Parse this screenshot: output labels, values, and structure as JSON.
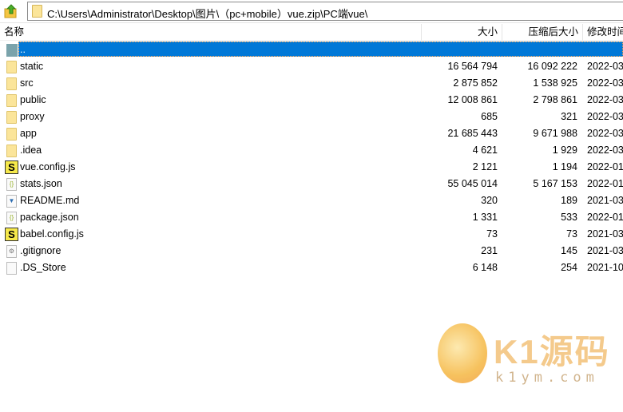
{
  "toolbar": {
    "path": "C:\\Users\\Administrator\\Desktop\\图片\\（pc+mobile）vue.zip\\PC端vue\\"
  },
  "columns": {
    "name": "名称",
    "size": "大小",
    "packed": "压缩后大小",
    "modified": "修改时间"
  },
  "rows": [
    {
      "name": "..",
      "size": "",
      "packed": "",
      "modified": "",
      "icon": "parent",
      "selected": true
    },
    {
      "name": "static",
      "size": "16 564 794",
      "packed": "16 092 222",
      "modified": "2022-03",
      "icon": "folder"
    },
    {
      "name": "src",
      "size": "2 875 852",
      "packed": "1 538 925",
      "modified": "2022-03",
      "icon": "folder"
    },
    {
      "name": "public",
      "size": "12 008 861",
      "packed": "2 798 861",
      "modified": "2022-03",
      "icon": "folder"
    },
    {
      "name": "proxy",
      "size": "685",
      "packed": "321",
      "modified": "2022-03",
      "icon": "folder"
    },
    {
      "name": "app",
      "size": "21 685 443",
      "packed": "9 671 988",
      "modified": "2022-03",
      "icon": "folder"
    },
    {
      "name": ".idea",
      "size": "4 621",
      "packed": "1 929",
      "modified": "2022-03",
      "icon": "folder"
    },
    {
      "name": "vue.config.js",
      "size": "2 121",
      "packed": "1 194",
      "modified": "2022-01",
      "icon": "js"
    },
    {
      "name": "stats.json",
      "size": "55 045 014",
      "packed": "5 167 153",
      "modified": "2022-01",
      "icon": "json"
    },
    {
      "name": "README.md",
      "size": "320",
      "packed": "189",
      "modified": "2021-03",
      "icon": "md"
    },
    {
      "name": "package.json",
      "size": "1 331",
      "packed": "533",
      "modified": "2022-01",
      "icon": "json"
    },
    {
      "name": "babel.config.js",
      "size": "73",
      "packed": "73",
      "modified": "2021-03",
      "icon": "js"
    },
    {
      "name": ".gitignore",
      "size": "231",
      "packed": "145",
      "modified": "2021-03",
      "icon": "gear"
    },
    {
      "name": ".DS_Store",
      "size": "6 148",
      "packed": "254",
      "modified": "2021-10",
      "icon": "file"
    }
  ],
  "watermark": {
    "brand": "K1源码",
    "url": "k1ym.com"
  }
}
